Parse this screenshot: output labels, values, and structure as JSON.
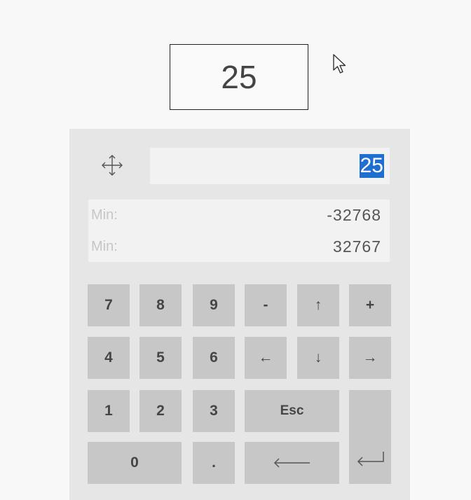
{
  "display": {
    "value": "25"
  },
  "input": {
    "selected_text": "25"
  },
  "limits": [
    {
      "label": "Min:",
      "value": "-32768"
    },
    {
      "label": "Min:",
      "value": "32767"
    }
  ],
  "keys": {
    "seven": "7",
    "eight": "8",
    "nine": "9",
    "minus": "-",
    "plus": "+",
    "four": "4",
    "five": "5",
    "six": "6",
    "one": "1",
    "two": "2",
    "three": "3",
    "esc": "Esc",
    "zero": "0",
    "dot": ".",
    "up": "↑",
    "down": "↓",
    "left": "←",
    "right": "→"
  },
  "icons": {
    "move": "move-icon",
    "cursor": "mouse-pointer-icon",
    "backspace": "backspace-arrow-icon",
    "enter": "enter-icon"
  }
}
